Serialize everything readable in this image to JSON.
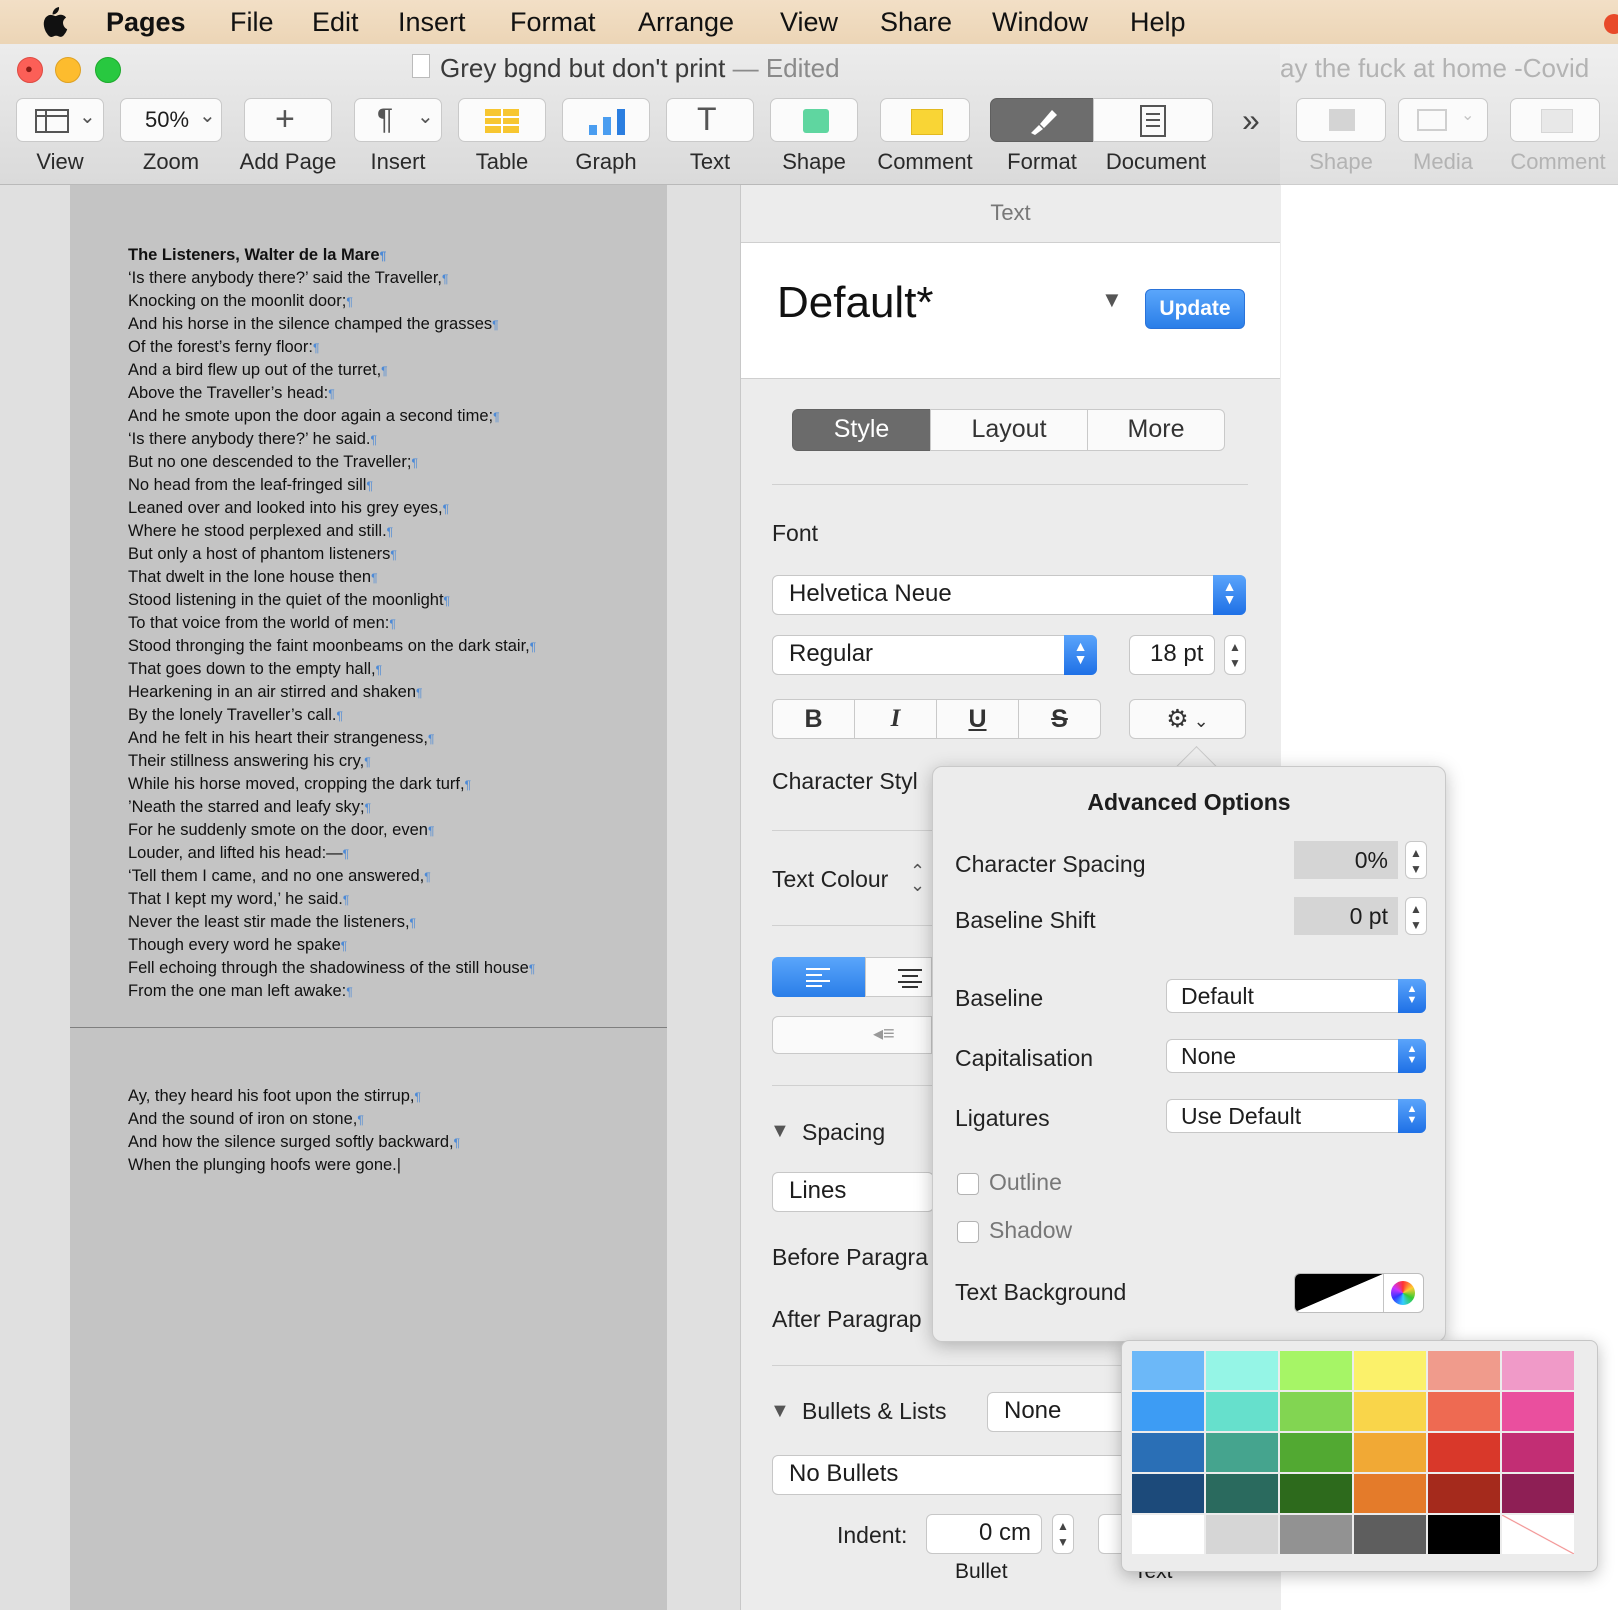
{
  "menubar": {
    "app": "Pages",
    "items": [
      "File",
      "Edit",
      "Insert",
      "Format",
      "Arrange",
      "View",
      "Share",
      "Window",
      "Help"
    ]
  },
  "window": {
    "title": "Grey bgnd but don't print",
    "edited": "— Edited",
    "other_title": "ay the fuck at home -Covid",
    "toolbar": {
      "zoom_value": "50%",
      "labels": [
        "View",
        "Zoom",
        "Add Page",
        "Insert",
        "Table",
        "Graph",
        "Text",
        "Shape",
        "Comment",
        "Format",
        "Document"
      ],
      "overflow": "»",
      "other_labels": [
        "Shape",
        "Media",
        "Comment"
      ]
    }
  },
  "document": {
    "page1_lines": [
      "The Listeners, Walter de la Mare",
      "‘Is there anybody there?’ said the Traveller,",
      "Knocking on the moonlit door;",
      "And his horse in the silence champed the grasses",
      "Of the forest’s ferny floor:",
      "And a bird flew up out of the turret,",
      "Above the Traveller’s head:",
      "And he smote upon the door again a second time;",
      "‘Is there anybody there?’ he said.",
      "But no one descended to the Traveller;",
      "No head from the leaf-fringed sill",
      "Leaned over and looked into his grey eyes,",
      "Where he stood perplexed and still.",
      "But only a host of phantom listeners",
      "That dwelt in the lone house then",
      "Stood listening in the quiet of the moonlight",
      "To that voice from the world of men:",
      "Stood thronging the faint moonbeams on the dark stair,",
      "That goes down to the empty hall,",
      "Hearkening in an air stirred and shaken",
      "By the lonely Traveller’s call.",
      "And he felt in his heart their strangeness,",
      "Their stillness answering his cry,",
      "While his horse moved, cropping the dark turf,",
      "’Neath the starred and leafy sky;",
      "For he suddenly smote on the door, even",
      "Louder, and lifted his head:—",
      "‘Tell them I came, and no one answered,",
      "That I kept my word,’ he said.",
      "Never the least stir made the listeners,",
      "Though every word he spake",
      "Fell echoing through the shadowiness of the still house",
      "From the one man left awake:"
    ],
    "page2_lines": [
      "Ay, they heard his foot upon the stirrup,",
      "And the sound of iron on stone,",
      "And how the silence surged softly backward,",
      "When the plunging hoofs were gone."
    ],
    "pilcrow": "¶"
  },
  "inspector": {
    "header": "Text",
    "style_name": "Default*",
    "update": "Update",
    "tabs": [
      "Style",
      "Layout",
      "More"
    ],
    "font_label": "Font",
    "font_family": "Helvetica Neue",
    "font_style": "Regular",
    "font_size": "18 pt",
    "format_buttons": [
      "B",
      "I",
      "U",
      "S"
    ],
    "character_style": "Character Styl",
    "text_colour": "Text Colour",
    "spacing": "Spacing",
    "spacing_value": "Lines",
    "before_paragraph": "Before Paragra",
    "after_paragraph": "After Paragrap",
    "bullets_lists": "Bullets & Lists",
    "bullets_value": "None",
    "bullets_style": "No Bullets",
    "indent_label": "Indent:",
    "indent_value": "0 cm",
    "bullet_label": "Bullet",
    "text_label": "Text"
  },
  "advanced": {
    "title": "Advanced Options",
    "character_spacing_label": "Character Spacing",
    "character_spacing": "0%",
    "baseline_shift_label": "Baseline Shift",
    "baseline_shift": "0 pt",
    "baseline_label": "Baseline",
    "baseline": "Default",
    "capitalisation_label": "Capitalisation",
    "capitalisation": "None",
    "ligatures_label": "Ligatures",
    "ligatures": "Use Default",
    "outline": "Outline",
    "shadow": "Shadow",
    "text_background": "Text Background"
  },
  "swatches": [
    [
      "#6cb8f8",
      "#95f5e6",
      "#a6f566",
      "#fbf16a",
      "#f09b8c",
      "#f09ac8"
    ],
    [
      "#3d9cf4",
      "#66e0cc",
      "#82d552",
      "#f9d54a",
      "#ee6a52",
      "#ea4f9e"
    ],
    [
      "#2a6fb6",
      "#45a48e",
      "#52a932",
      "#f1a935",
      "#d9382a",
      "#c22e74"
    ],
    [
      "#1c4a7a",
      "#2a6a5e",
      "#2d6a1c",
      "#e47b2a",
      "#a52a1c",
      "#8e1f55"
    ],
    [
      "#ffffff",
      "#d6d6d6",
      "#929292",
      "#5e5e5e",
      "#000000",
      "none"
    ]
  ]
}
